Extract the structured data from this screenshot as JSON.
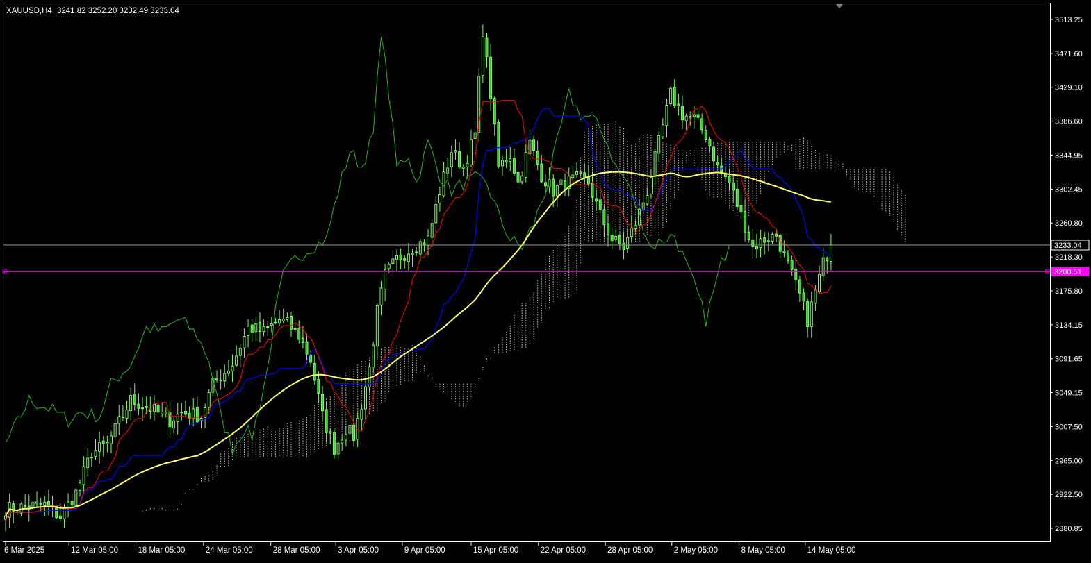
{
  "symbol_header": {
    "symbol": "XAUUSD,H4",
    "ohlc": "3241.82 3252.20 3232.49 3233.04"
  },
  "price_levels": {
    "current_price": "3233.04",
    "horizontal_line": "3200.51"
  },
  "colors": {
    "background": "#000000",
    "frame": "#ffffff",
    "candle_body": "#32cd32",
    "candle_wick": "#7dfc5a",
    "tenkan": "#ff0000",
    "kijun": "#0000ff",
    "chikou": "#22b822",
    "moving_average": "#ffff66",
    "kumo": "#d8c2b6",
    "current_price_line": "#9a9a9a",
    "horizontal_line": "#ff00ff",
    "axis_text": "#ffffff"
  },
  "chart_data": {
    "type": "candlestick",
    "indicators": [
      "Ichimoku Kinko Hyo",
      "Moving Average"
    ],
    "y_ticks": [
      "3513.25",
      "3471.60",
      "3429.10",
      "3386.60",
      "3344.95",
      "3302.45",
      "3260.80",
      "3218.30",
      "3175.80",
      "3134.15",
      "3091.65",
      "3049.15",
      "3007.50",
      "2965.00",
      "2922.50",
      "2880.85"
    ],
    "x_ticks": [
      "6 Mar 2025",
      "12 Mar 05:00",
      "18 Mar 05:00",
      "24 Mar 05:00",
      "28 Mar 05:00",
      "3 Apr 05:00",
      "9 Apr 05:00",
      "15 Apr 05:00",
      "22 Apr 05:00",
      "28 Apr 05:00",
      "2 May 05:00",
      "8 May 05:00",
      "14 May 05:00"
    ],
    "ylim": [
      2880.85,
      3513.25
    ],
    "grid": false,
    "close_path": [
      [
        0,
        2905
      ],
      [
        10,
        2910
      ],
      [
        14,
        2895
      ],
      [
        18,
        2925
      ],
      [
        22,
        2975
      ],
      [
        26,
        2985
      ],
      [
        32,
        3040
      ],
      [
        37,
        3030
      ],
      [
        42,
        3015
      ],
      [
        45,
        3025
      ],
      [
        50,
        3020
      ],
      [
        53,
        3060
      ],
      [
        58,
        3085
      ],
      [
        62,
        3130
      ],
      [
        66,
        3125
      ],
      [
        70,
        3140
      ],
      [
        72,
        3135
      ],
      [
        75,
        3120
      ],
      [
        78,
        3090
      ],
      [
        81,
        3020
      ],
      [
        84,
        2980
      ],
      [
        87,
        3005
      ],
      [
        89,
        2995
      ],
      [
        91,
        3035
      ],
      [
        93,
        3080
      ],
      [
        95,
        3150
      ],
      [
        97,
        3195
      ],
      [
        100,
        3215
      ],
      [
        104,
        3230
      ],
      [
        108,
        3240
      ],
      [
        111,
        3300
      ],
      [
        114,
        3350
      ],
      [
        117,
        3330
      ],
      [
        120,
        3370
      ],
      [
        122,
        3500
      ],
      [
        124,
        3420
      ],
      [
        126,
        3330
      ],
      [
        129,
        3345
      ],
      [
        131,
        3310
      ],
      [
        134,
        3360
      ],
      [
        137,
        3320
      ],
      [
        140,
        3300
      ],
      [
        143,
        3310
      ],
      [
        146,
        3315
      ],
      [
        149,
        3310
      ],
      [
        152,
        3270
      ],
      [
        155,
        3240
      ],
      [
        158,
        3230
      ],
      [
        161,
        3260
      ],
      [
        164,
        3300
      ],
      [
        167,
        3360
      ],
      [
        170,
        3420
      ],
      [
        173,
        3395
      ],
      [
        176,
        3390
      ],
      [
        179,
        3370
      ],
      [
        182,
        3330
      ],
      [
        185,
        3310
      ],
      [
        188,
        3270
      ],
      [
        191,
        3230
      ],
      [
        194,
        3240
      ],
      [
        197,
        3245
      ],
      [
        199,
        3220
      ],
      [
        201,
        3195
      ],
      [
        203,
        3170
      ],
      [
        205,
        3140
      ],
      [
        207,
        3175
      ],
      [
        209,
        3210
      ],
      [
        211,
        3233
      ]
    ]
  }
}
